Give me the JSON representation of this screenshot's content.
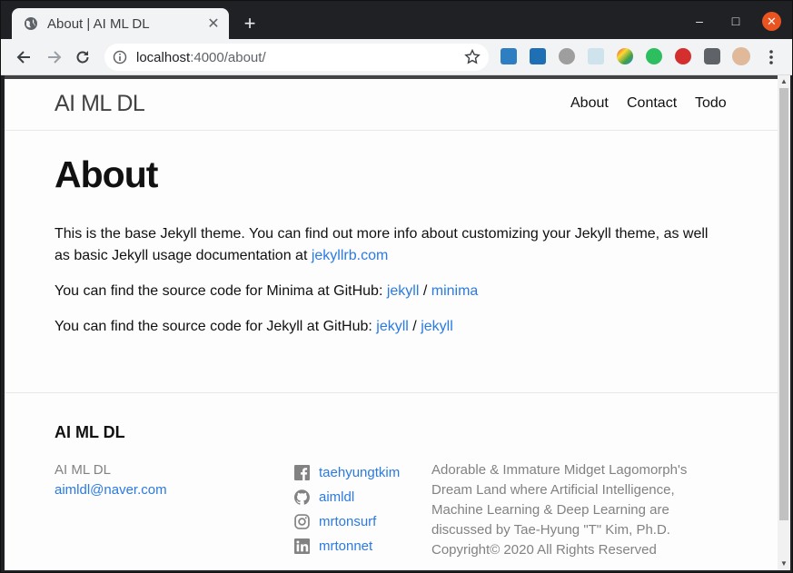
{
  "browser": {
    "tab_title": "About | AI ML DL",
    "tab_close": "✕",
    "new_tab": "+",
    "url_host": "localhost",
    "url_path": ":4000/about/",
    "window_controls": {
      "minimize": "–",
      "maximize": "□",
      "close": "✕"
    }
  },
  "site": {
    "title": "AI ML DL",
    "nav": [
      "About",
      "Contact",
      "Todo"
    ]
  },
  "page": {
    "heading": "About",
    "para1_text": "This is the base Jekyll theme. You can find out more info about customizing your Jekyll theme, as well as basic Jekyll usage documentation at ",
    "para1_link": "jekyllrb.com",
    "para2_text": "You can find the source code for Minima at GitHub: ",
    "para2_link1": "jekyll",
    "para2_sep": " / ",
    "para2_link2": "minima",
    "para3_text": "You can find the source code for Jekyll at GitHub: ",
    "para3_link1": "jekyll",
    "para3_sep": " / ",
    "para3_link2": "jekyll"
  },
  "footer": {
    "heading": "AI ML DL",
    "name": "AI ML DL",
    "email": "aimldl@naver.com",
    "social": [
      {
        "icon": "facebook-icon",
        "label": "taehyungtkim"
      },
      {
        "icon": "github-icon",
        "label": "aimldl"
      },
      {
        "icon": "instagram-icon",
        "label": "mrtonsurf"
      },
      {
        "icon": "linkedin-icon",
        "label": "mrtonnet"
      }
    ],
    "description": "Adorable & Immature Midget Lagomorph's Dream Land where Artificial Intelligence, Machine Learning & Deep Learning are discussed by Tae-Hyung \"T\" Kim, Ph.D. Copyright© 2020 All Rights Reserved"
  },
  "colors": {
    "link": "#2a7ae2",
    "muted": "#828282",
    "close_button": "#e95420"
  }
}
